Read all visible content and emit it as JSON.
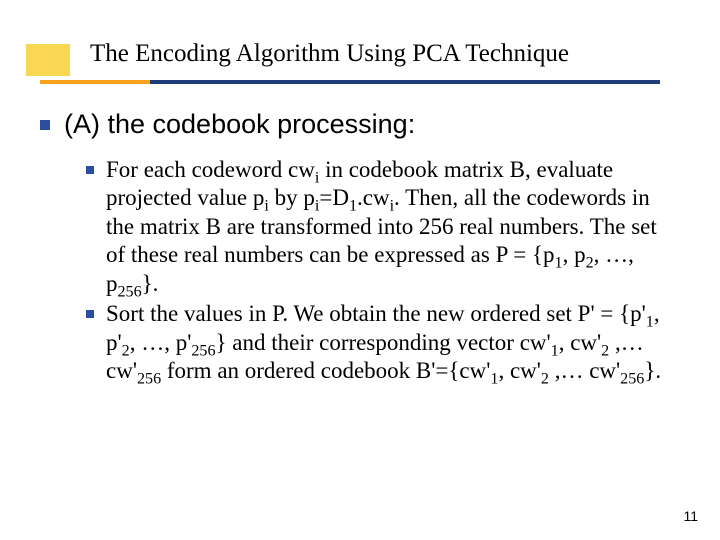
{
  "title": "The Encoding Algorithm Using PCA Technique",
  "l1": "(A) the codebook processing:",
  "b1a": "For each codeword cw",
  "b1b": " in codebook matrix B, evaluate projected value p",
  "b1c": " by p",
  "b1d": "=D",
  "b1e": ".cw",
  "b1f": ". Then, all the codewords in the matrix B are transformed into 256 real numbers. The set of these real numbers can be expressed as P = {p",
  "b1g": ", p",
  "b1h": ", …, p",
  "b1i": "}.",
  "b2a": "Sort the values in P. We obtain the new ordered set P' = {p'",
  "b2b": ", p'",
  "b2c": ", …, p'",
  "b2d": "} and their corresponding vector cw'",
  "b2e": ", cw'",
  "b2f": " ,… cw'",
  "b2g": " form an ordered codebook B'={cw'",
  "b2h": ", cw'",
  "b2i": " ,… cw'",
  "b2j": "}.",
  "s_i": "i",
  "s_1": "1",
  "s_2": "2",
  "s_256": "256",
  "pagenum": "11"
}
